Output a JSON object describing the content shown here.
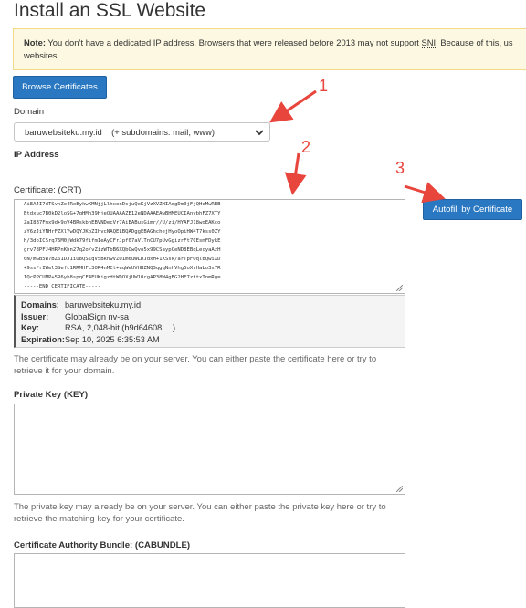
{
  "page": {
    "title": "Install an SSL Website"
  },
  "note": {
    "prefix": "Note:",
    "text_before": " You don’t have a dedicated IP address. Browsers that were released before 2013 may not support ",
    "abbr": "SNI",
    "text_after": ". Because of this, us",
    "line2": "websites."
  },
  "buttons": {
    "browse": "Browse Certificates",
    "autofill": "Autofill by Certificate"
  },
  "domain": {
    "label": "Domain",
    "selected": "baruwebsiteku.my.id    (+ subdomains: mail, www)"
  },
  "ip": {
    "label": "IP Address"
  },
  "certificate": {
    "label": "Certificate: (CRT)",
    "lines": [
      "AiEA4I7dTSvnZe4RoEykwKMNjjLlhxenDsjuQoKjVzXVZHIAdgDm0jFjQHeMwRBB",
      "Btdxuc7B0kD2loSG+7qHMh39HjeOUAAAAZE12eNDAAAEAwBHMEUCIAnybhFZ7XTY",
      "ZaI8B7Fmx9d+9oV4BRskbnEBVNDecVr7AiEABusGimr//U/zi/HYAFJ18woEAKco",
      "zY6zJiYNHrFZXlYwDQYJKoZIhvcNAQELBQADggEBAGhchejHyoOpiHW4T7kss0ZY",
      "H/3doICSrq76M0jWdk79fifm1eAyCFrJpf07aVlTnCU7pUvGgizrFt7CEsmFDykE",
      "grv78PFJ4HRPnKhn27q2o/vZizWTbB6XQbOwQvo5x99CSaypCeND8EBqLecyaAzH",
      "0N/mGB5W7BZ61DJ1iU8QSZqV5BknwVZO1m6uWLDJdxH+1XSsk/arTpFQqlbQwiXD",
      "+9ss/rIWel3Sefc1RRMHFc3OR4nMCt+uqWeUVHBZNQSqgqNnhVhg5oXvHaLo3s7R",
      "IQcPPCUMP+5R6yb8spqCF4EUKigzHtWDOXjUW1OcgAP38W4gBG2HE7zttxTnmRg=",
      "-----END CERTIFICATE-----"
    ]
  },
  "cert_info": {
    "domains_label": "Domains:",
    "domains": "baruwebsiteku.my.id",
    "issuer_label": "Issuer:",
    "issuer": "GlobalSign nv-sa",
    "key_label": "Key:",
    "key": "RSA, 2,048-bit (b9d64608 …)",
    "expiration_label": "Expiration:",
    "expiration": "Sep 10, 2025 6:35:53 AM"
  },
  "help": {
    "certificate": "The certificate may already be on your server. You can either paste the certificate here or try to retrieve it for your domain.",
    "private_key": "The private key may already be on your server. You can either paste the private key here or try to retrieve the matching key for your certificate."
  },
  "private_key": {
    "label": "Private Key (KEY)"
  },
  "cabundle": {
    "label": "Certificate Authority Bundle: (CABUNDLE)"
  },
  "annotations": [
    "1",
    "2",
    "3"
  ],
  "colors": {
    "primary": "#2a78c2",
    "note_bg": "#fcf8e1",
    "note_border": "#f3d98a",
    "annotation": "#e8453c"
  }
}
